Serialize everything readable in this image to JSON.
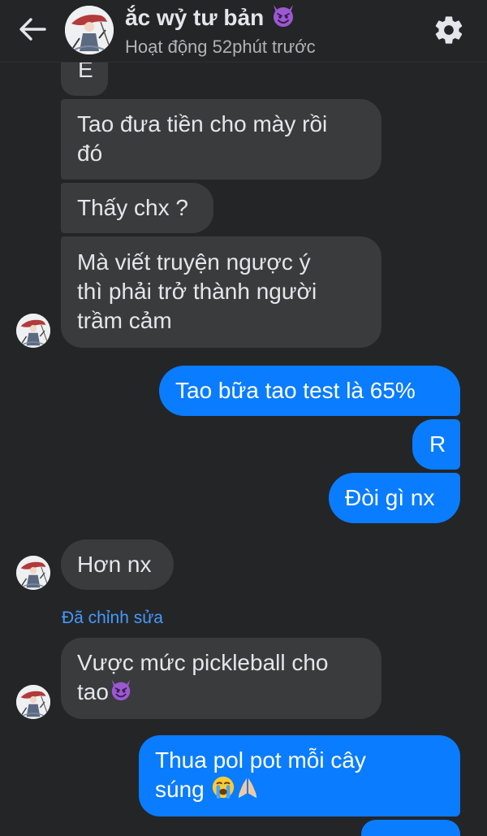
{
  "header": {
    "contact_name": "ắc wỷ tư bản",
    "status": "Hoạt động 52phút trước"
  },
  "edited_label": "Đã chỉnh sửa",
  "messages": [
    {
      "direction": "incoming",
      "text": "E"
    },
    {
      "direction": "incoming",
      "lines": [
        "Tao đưa tiền cho mày rồi",
        "đó"
      ]
    },
    {
      "direction": "incoming",
      "text": "Thấy chx ?"
    },
    {
      "direction": "incoming",
      "lines": [
        "Mà viết truyện ngược ý",
        "thì phải trở thành người",
        "trầm cảm"
      ]
    },
    {
      "direction": "outgoing",
      "text": "Tao bữa tao test là 65%"
    },
    {
      "direction": "outgoing",
      "text": "R"
    },
    {
      "direction": "outgoing",
      "text": "Đòi gì nx"
    },
    {
      "direction": "incoming",
      "text": "Hơn nx"
    },
    {
      "direction": "incoming",
      "lines": [
        "Vược mức pickleball cho",
        "tao"
      ],
      "emoji": "smiling-devil"
    },
    {
      "direction": "outgoing",
      "lines": [
        "Thua pol pot mỗi cây",
        "súng"
      ],
      "emojis": [
        "loudly-crying",
        "folded-hands"
      ]
    }
  ],
  "icons": {
    "back": "arrow-left-icon",
    "settings": "gear-icon",
    "name_emoji": "smiling-devil"
  },
  "colors": {
    "background": "#242526",
    "incoming_bubble": "#3a3b3c",
    "outgoing_bubble": "#0a7cff",
    "edited_label": "#4599ff"
  }
}
